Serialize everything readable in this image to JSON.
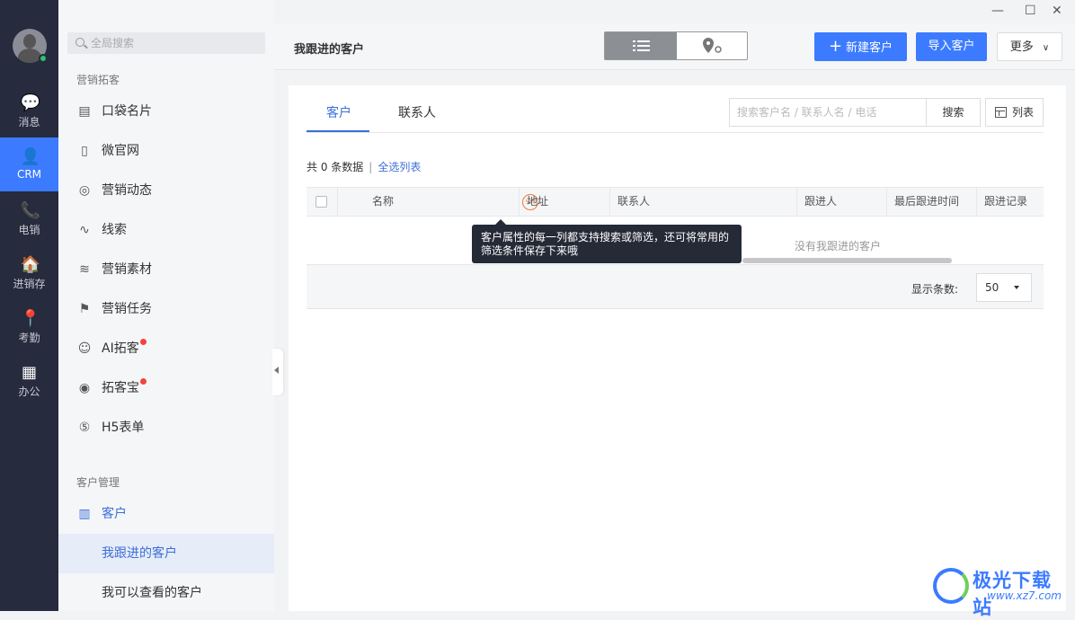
{
  "window": {
    "minimize": "—",
    "maximize": "☐",
    "close": "✕"
  },
  "rail": {
    "items": [
      {
        "label": "消息",
        "icon": "chat-bubble-icon"
      },
      {
        "label": "CRM",
        "icon": "person-icon",
        "active": true
      },
      {
        "label": "电销",
        "icon": "phone-icon"
      },
      {
        "label": "进销存",
        "icon": "house-icon"
      },
      {
        "label": "考勤",
        "icon": "location-pin-icon"
      },
      {
        "label": "办公",
        "icon": "grid-icon"
      }
    ]
  },
  "sidebar": {
    "search_placeholder": "全局搜索",
    "section_marketing": "营销拓客",
    "items": [
      {
        "label": "口袋名片"
      },
      {
        "label": "微官网"
      },
      {
        "label": "营销动态"
      },
      {
        "label": "线索"
      },
      {
        "label": "营销素材"
      },
      {
        "label": "营销任务"
      },
      {
        "label": "AI拓客",
        "badge": true
      },
      {
        "label": "拓客宝",
        "badge": true
      },
      {
        "label": "H5表单"
      }
    ],
    "section_customer": "客户管理",
    "customer": {
      "label": "客户"
    },
    "sub": [
      {
        "label": "我跟进的客户",
        "selected": true
      },
      {
        "label": "我可以查看的客户"
      }
    ]
  },
  "header": {
    "title": "我跟进的客户",
    "new_customer": "新建客户",
    "import_customer": "导入客户",
    "more": "更多"
  },
  "main": {
    "tabs": [
      {
        "label": "客户",
        "active": true
      },
      {
        "label": "联系人"
      }
    ],
    "search_placeholder": "搜索客户名 / 联系人名 / 电话",
    "search_button": "搜索",
    "view_button": "列表",
    "count_text": "共 0 条数据",
    "separator": "|",
    "select_all_link": "全选列表",
    "columns": [
      "名称",
      "地址",
      "联系人",
      "跟进人",
      "最后跟进时间",
      "跟进记录"
    ],
    "empty_text": "没有我跟进的客户",
    "page_size_label": "显示条数:",
    "page_size_value": "50",
    "tooltip": "客户属性的每一列都支持搜索或筛选，还可将常用的筛选条件保存下来哦"
  },
  "watermark": {
    "title": "极光下载站",
    "url": "www.xz7.com"
  },
  "colors": {
    "accent": "#3c7bff",
    "rail": "#262b3d",
    "tooltip": "#252a37",
    "filter_orange": "#f07c3b"
  }
}
